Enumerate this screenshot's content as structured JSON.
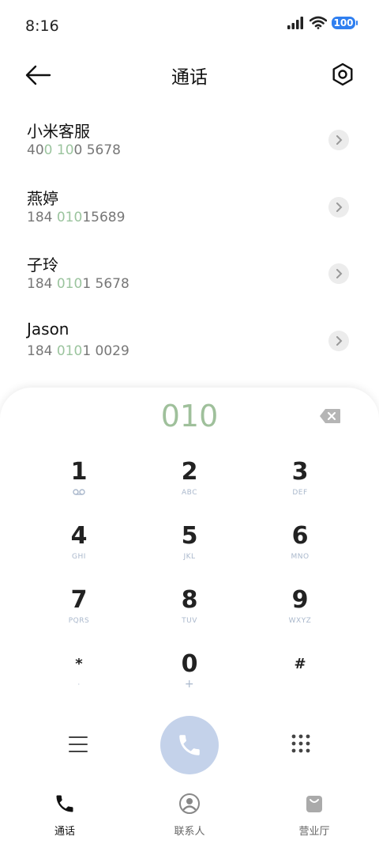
{
  "status": {
    "time": "8:16",
    "battery": "100"
  },
  "header": {
    "title": "通话"
  },
  "contacts": [
    {
      "name": "小米客服",
      "num_pre": "40",
      "num_hl1": "0",
      "num_mid": " ",
      "num_hl2": "10",
      "num_post": "0 5678"
    },
    {
      "name": "燕婷",
      "num_pre": "184 ",
      "num_hl1": "010",
      "num_mid": "",
      "num_hl2": "",
      "num_post": "15689"
    },
    {
      "name": "子玲",
      "num_pre": "184 ",
      "num_hl1": "010",
      "num_mid": "",
      "num_hl2": "",
      "num_post": "1 5678"
    },
    {
      "name": "Jason",
      "num_pre": "184 ",
      "num_hl1": "010",
      "num_mid": "",
      "num_hl2": "",
      "num_post": "1 0029"
    }
  ],
  "dialer": {
    "display": "010",
    "keys": [
      {
        "digit": "1",
        "letters": ""
      },
      {
        "digit": "2",
        "letters": "ABC"
      },
      {
        "digit": "3",
        "letters": "DEF"
      },
      {
        "digit": "4",
        "letters": "GHI"
      },
      {
        "digit": "5",
        "letters": "JKL"
      },
      {
        "digit": "6",
        "letters": "MNO"
      },
      {
        "digit": "7",
        "letters": "PQRS"
      },
      {
        "digit": "8",
        "letters": "TUV"
      },
      {
        "digit": "9",
        "letters": "WXYZ"
      },
      {
        "digit": "*",
        "letters": "·"
      },
      {
        "digit": "0",
        "letters": "+"
      },
      {
        "digit": "#",
        "letters": ""
      }
    ]
  },
  "nav": {
    "tabs": [
      {
        "label": "通话",
        "icon": "phone-icon"
      },
      {
        "label": "联系人",
        "icon": "person-icon"
      },
      {
        "label": "营业厅",
        "icon": "shopping-bag-icon"
      }
    ]
  },
  "colors": {
    "accent": "#9bc49e",
    "call_button": "#c4d2ea",
    "battery": "#2f7ff0"
  }
}
